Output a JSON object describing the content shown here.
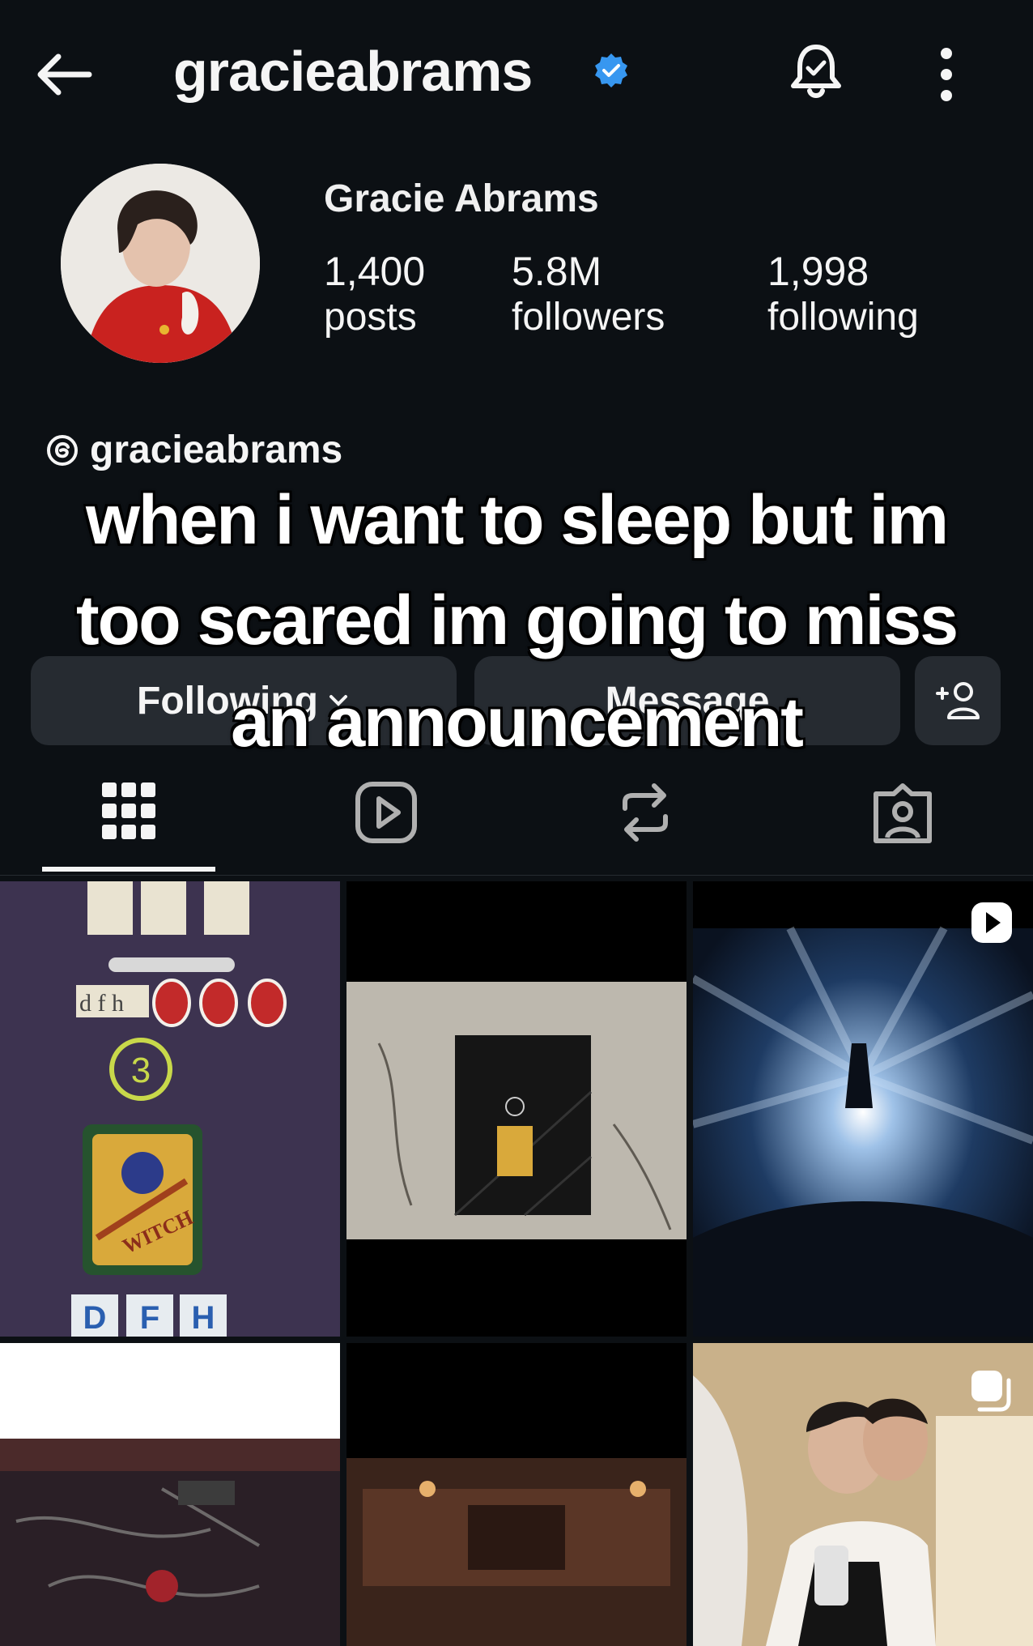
{
  "header": {
    "username": "gracieabrams",
    "icons": [
      "back-arrow-icon",
      "verified-badge-icon",
      "notification-bell-icon",
      "more-options-icon"
    ]
  },
  "profile": {
    "display_name": "Gracie Abrams",
    "stats": [
      {
        "value": "1,400",
        "label": "posts"
      },
      {
        "value": "5.8M",
        "label": "followers"
      },
      {
        "value": "1,998",
        "label": "following"
      }
    ],
    "threads_handle": "gracieabrams"
  },
  "actions": {
    "following_label": "Following",
    "message_label": "Message"
  },
  "caption": {
    "line1": "when i want to sleep but im",
    "line2": "too scared im going to miss",
    "line3": "an announcement"
  },
  "tabs": [
    "grid-icon",
    "reels-icon",
    "reposts-icon",
    "tagged-icon"
  ],
  "grid": {
    "witch_text": "WITCH",
    "card_number": "3",
    "tiles_bottom": [
      "D",
      "F",
      "H"
    ],
    "tiles_top": [
      "d",
      "f",
      "h"
    ]
  },
  "colors": {
    "background": "#0c1014",
    "button": "#262b31",
    "verified": "#3797f0"
  }
}
